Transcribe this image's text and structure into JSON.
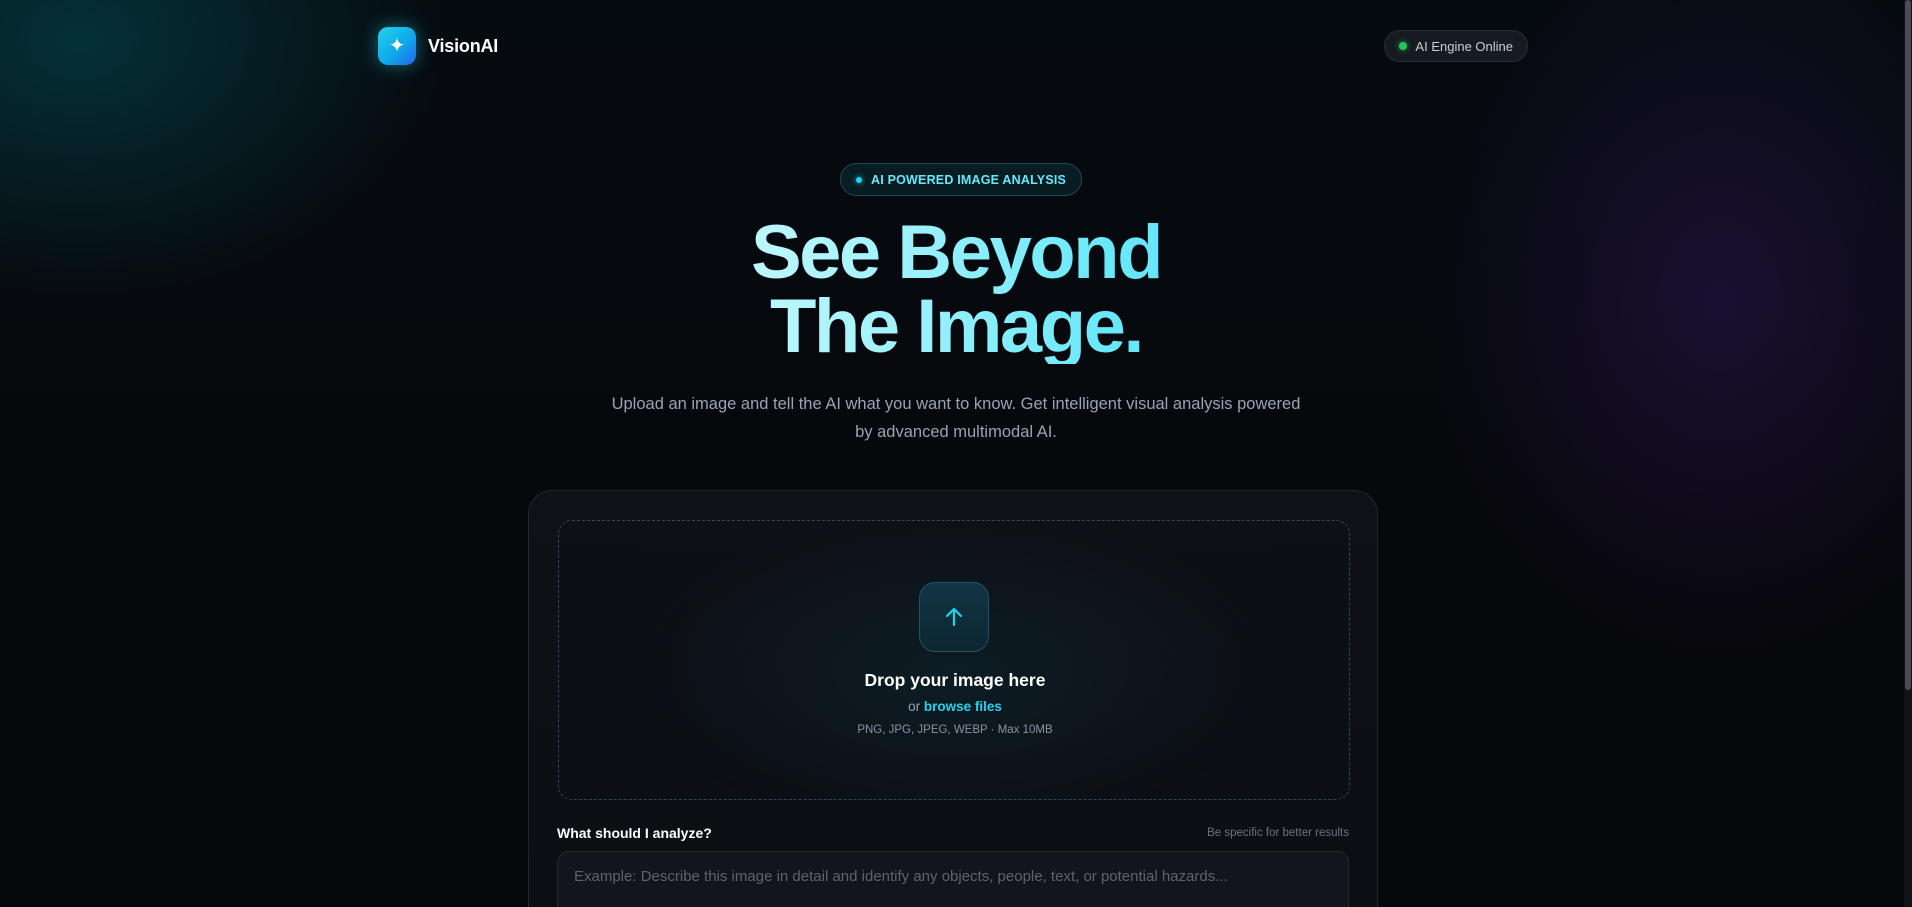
{
  "header": {
    "brand_name": "VisionAI",
    "logo_icon": "sparkle-icon",
    "status_label": "AI Engine Online",
    "status_color": "#22c55e"
  },
  "hero": {
    "badge": "AI POWERED IMAGE ANALYSIS",
    "title_line1": "See Beyond",
    "title_line2": "The Image.",
    "subtitle": "Upload an image and tell the AI what you want to know. Get intelligent visual analysis powered by advanced multimodal AI."
  },
  "upload": {
    "icon": "arrow-up-icon",
    "title": "Drop your image here",
    "or_text": "or",
    "browse_label": "browse files",
    "formats": "PNG, JPG, JPEG, WEBP · Max 10MB"
  },
  "prompt": {
    "label": "What should I analyze?",
    "hint": "Be specific for better results",
    "value": "",
    "placeholder": "Example: Describe this image in detail and identify any objects, people, text, or potential hazards..."
  },
  "colors": {
    "accent": "#22d3ee",
    "background": "#07080c",
    "card": "#0f1117"
  }
}
